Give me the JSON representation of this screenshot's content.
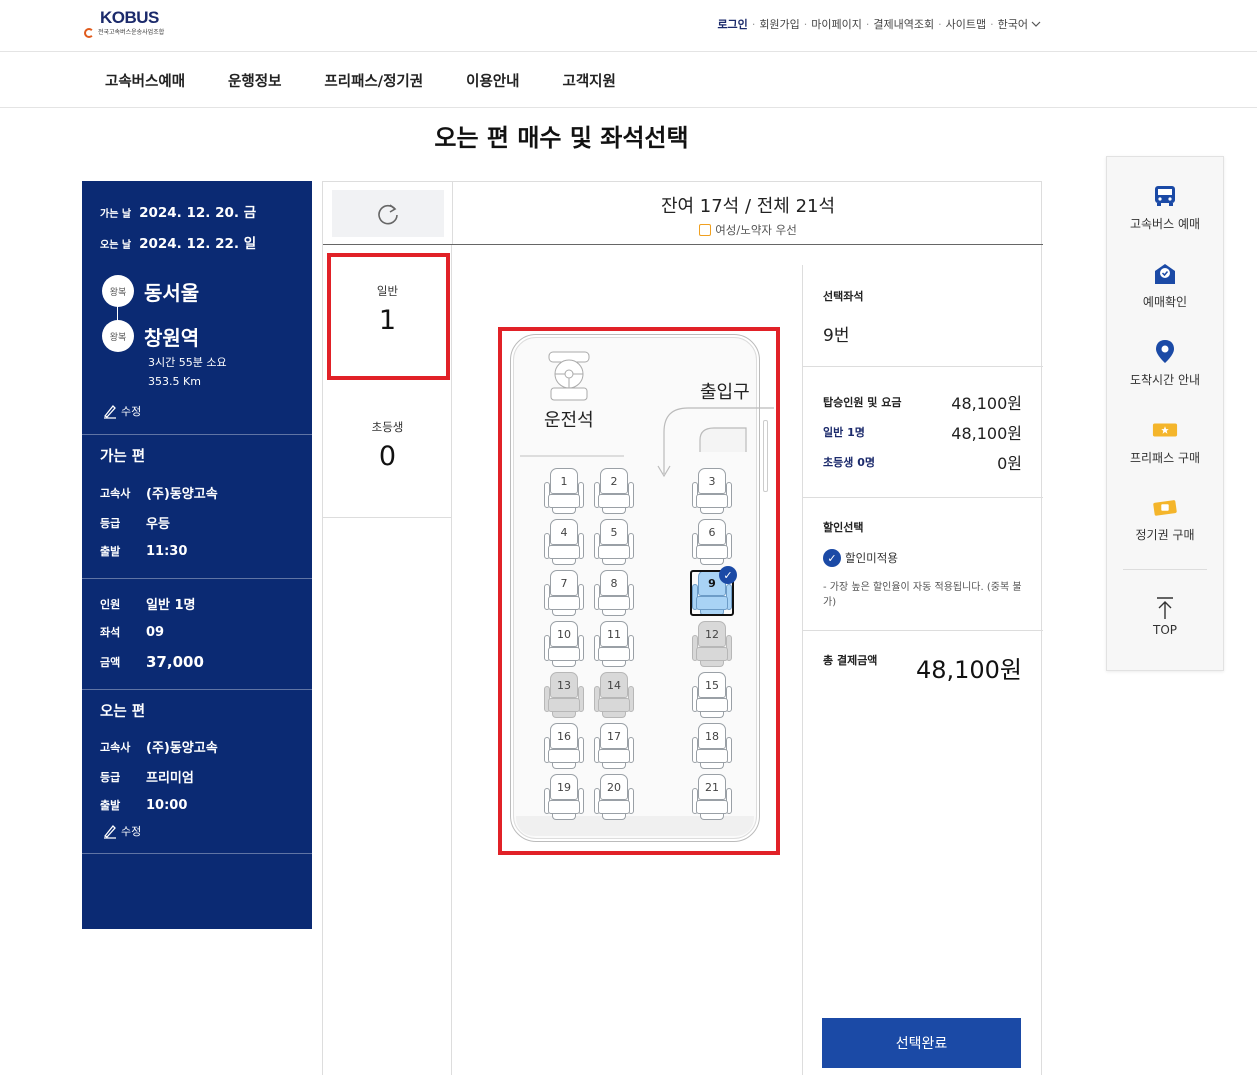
{
  "header": {
    "logo_text": "KOBUS",
    "logo_sub": "전국고속버스운송사업조합",
    "util_links": [
      "로그인",
      "회원가입",
      "마이페이지",
      "결제내역조회",
      "사이트맵",
      "한국어"
    ]
  },
  "gnb": [
    "고속버스예매",
    "운행정보",
    "프리패스/정기권",
    "이용안내",
    "고객지원"
  ],
  "page_title": "오는 편 매수 및 좌석선택",
  "info": {
    "go_date_label": "가는 날",
    "go_date": "2024. 12. 20. 금",
    "return_date_label": "오는 날",
    "return_date": "2024. 12. 22. 일",
    "badge": "왕복",
    "from": "동서울",
    "to": "창원역",
    "duration": "3시간 55분 소요",
    "distance": "353.5 Km",
    "edit": "수정",
    "outbound": {
      "title": "가는 편",
      "company_label": "고속사",
      "company": "(주)동양고속",
      "grade_label": "등급",
      "grade": "우등",
      "depart_label": "출발",
      "depart": "11:30"
    },
    "summary": {
      "people_label": "인원",
      "people": "일반 1명",
      "seat_label": "좌석",
      "seat": "09",
      "price_label": "금액",
      "price": "37,000"
    },
    "inbound": {
      "title": "오는 편",
      "company_label": "고속사",
      "company": "(주)동양고속",
      "grade_label": "등급",
      "grade": "프리미엄",
      "depart_label": "출발",
      "depart": "10:00"
    }
  },
  "seat_header": {
    "remaining": "잔여 17석 / 전체 21석",
    "priority": "여성/노약자 우선"
  },
  "counts": [
    {
      "label": "일반",
      "value": "1"
    },
    {
      "label": "초등생",
      "value": "0"
    }
  ],
  "bus": {
    "driver": "운전석",
    "exit": "출입구",
    "seats": [
      {
        "no": "1",
        "state": "free"
      },
      {
        "no": "2",
        "state": "free"
      },
      {
        "no": "3",
        "state": "free"
      },
      {
        "no": "4",
        "state": "free"
      },
      {
        "no": "5",
        "state": "free"
      },
      {
        "no": "6",
        "state": "free"
      },
      {
        "no": "7",
        "state": "free"
      },
      {
        "no": "8",
        "state": "free"
      },
      {
        "no": "9",
        "state": "selected"
      },
      {
        "no": "10",
        "state": "free"
      },
      {
        "no": "11",
        "state": "free"
      },
      {
        "no": "12",
        "state": "taken"
      },
      {
        "no": "13",
        "state": "taken"
      },
      {
        "no": "14",
        "state": "taken"
      },
      {
        "no": "15",
        "state": "free"
      },
      {
        "no": "16",
        "state": "free"
      },
      {
        "no": "17",
        "state": "free"
      },
      {
        "no": "18",
        "state": "free"
      },
      {
        "no": "19",
        "state": "free"
      },
      {
        "no": "20",
        "state": "free"
      },
      {
        "no": "21",
        "state": "free"
      }
    ]
  },
  "summary_panel": {
    "selected_seat_label": "선택좌석",
    "selected_seat": "9번",
    "fare_label": "탑승인원 및 요금",
    "fare_total": "48,100원",
    "adult_label": "일반 1명",
    "adult_fare": "48,100원",
    "child_label": "초등생 0명",
    "child_fare": "0원",
    "discount_label": "할인선택",
    "discount_option": "할인미적용",
    "discount_note": "- 가장 높은 할인율이 자동 적용됩니다. (중복 불가)",
    "total_label": "총 결제금액",
    "total": "48,100원",
    "done_button": "선택완료"
  },
  "quick_menu": [
    "고속버스 예매",
    "예매확인",
    "도착시간 안내",
    "프리패스 구매",
    "정기권 구매",
    "TOP"
  ],
  "colors": {
    "navy": "#0b2a73",
    "button_blue": "#1b4aa6",
    "highlight_red": "#e12127",
    "selected_seat": "#a9d3f5"
  }
}
